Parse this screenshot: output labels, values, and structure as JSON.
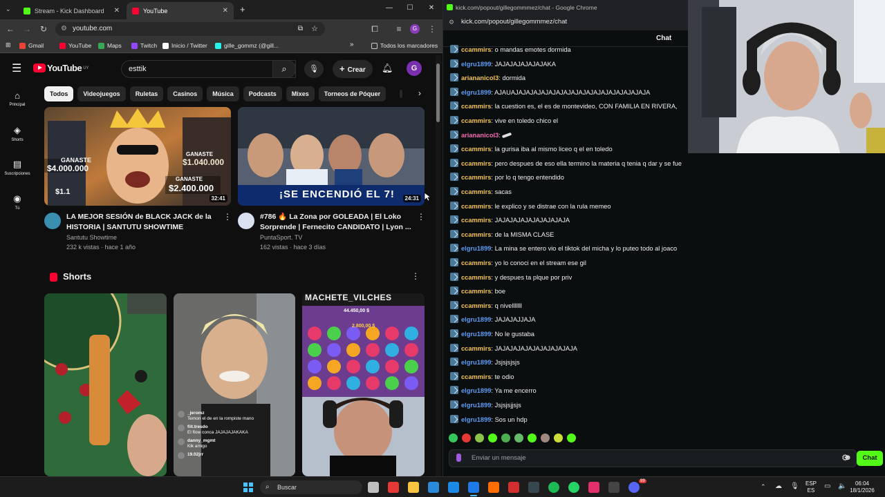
{
  "left_browser": {
    "tabs": [
      {
        "title": "Stream - Kick Dashboard",
        "favicon_color": "#53fc18",
        "active": false
      },
      {
        "title": "YouTube",
        "favicon_color": "#ff0033",
        "active": true
      }
    ],
    "new_tab_icon": "plus-icon",
    "url": "youtube.com",
    "bookmarks": [
      {
        "label": "Gmail",
        "color": "#ea4335"
      },
      {
        "label": "YouTube",
        "color": "#ff0033"
      },
      {
        "label": "Maps",
        "color": "#34a853"
      },
      {
        "label": "Twitch",
        "color": "#9146ff"
      },
      {
        "label": "Inicio / Twitter",
        "color": "#ffffff"
      },
      {
        "label": "gille_gommz (@gill...",
        "color": "#25f4ee"
      }
    ],
    "all_bookmarks": "Todos los marcadores"
  },
  "youtube": {
    "logo_text": "YouTube",
    "logo_region": "UY",
    "search_value": "esttik",
    "create_label": "Crear",
    "account_initial": "G",
    "guide": [
      {
        "label": "Principal",
        "icon": "home-icon"
      },
      {
        "label": "Shorts",
        "icon": "shorts-icon"
      },
      {
        "label": "Suscripciones",
        "icon": "subscriptions-icon"
      },
      {
        "label": "Tú",
        "icon": "you-icon"
      }
    ],
    "chips": [
      "Todos",
      "Videojuegos",
      "Ruletas",
      "Casinos",
      "Música",
      "Podcasts",
      "Mixes",
      "Torneos de Póquer"
    ],
    "videos": [
      {
        "title": "LA MEJOR SESIÓN de BLACK JACK de la HISTORIA | SANTUTU SHOWTIME",
        "channel": "Santutu Showtime",
        "meta": "232 k vistas · hace 1 año",
        "duration": "32:41",
        "overlay_texts": [
          "GANASTE",
          "$4.000.000",
          "GANASTE",
          "$1.040.000",
          "GANASTE",
          "$2.400.000",
          "$1.1"
        ],
        "thumb_color": "#4a3a2a"
      },
      {
        "title": "#786 🔥 La Zona por GOLEADA | El Loko Sorprende | Fernecito CANDIDATO | Lyon ...",
        "channel": "PuntaSport. TV",
        "meta": "162 vistas · hace 3 días",
        "duration": "24:31",
        "overlay_texts": [
          "¡SE ENCENDIÓ EL 7!"
        ],
        "thumb_color": "#3a4250"
      }
    ],
    "shorts_title": "Shorts",
    "shorts": [
      {
        "overlay": "",
        "color": "#2e6a3a"
      },
      {
        "overlay": "",
        "color": "#6a6a68"
      },
      {
        "overlay": "MACHETE_VILCHES",
        "color": "#6c3c8e"
      }
    ],
    "short_chat": [
      {
        "user": "_jeromz",
        "text": "Temon el de en la rompiste mano"
      },
      {
        "user": "fiit.tresdo",
        "text": "El flow conca JAJAJAJAKAKA"
      },
      {
        "user": "danny_mgmt",
        "text": "Klk amigo"
      },
      {
        "user": "19.02jrr",
        "text": ""
      }
    ],
    "slot_values": [
      "44.450,00 $",
      "2.800,00 $"
    ]
  },
  "right_browser": {
    "window_title": "kick.com/popout/gillegommmez/chat - Google Chrome",
    "url": "kick.com/popout/gillegommmez/chat",
    "chat_header": "Chat",
    "input_placeholder": "Enviar un mensaje",
    "send_label": "Chat",
    "messages": [
      {
        "user": "ccammirs",
        "color": "#f5c451",
        "text": "o mandas emotes dormida"
      },
      {
        "user": "elgru1899",
        "color": "#5d9cf5",
        "text": "JAJAJAJAJAJAJAKA"
      },
      {
        "user": "ariananicol3",
        "color": "#f5c451",
        "text": "dormida"
      },
      {
        "user": "elgru1899",
        "color": "#5d9cf5",
        "text": "AJAUAJAJAJAJAJAJAJAJAJAJAJAJAJAJAJAJAJAJA"
      },
      {
        "user": "ccammirs",
        "color": "#f5c451",
        "text": "la cuestion es, el es de montevideo, CON FAMILIA EN RIVERA,"
      },
      {
        "user": "ccammirs",
        "color": "#f5c451",
        "text": "vive en toledo chico el"
      },
      {
        "user": "ariananicol3",
        "color": "#f56bb5",
        "text": ""
      },
      {
        "user": "ccammirs",
        "color": "#f5c451",
        "text": "la gurisa iba al mismo liceo q el en toledo"
      },
      {
        "user": "ccammirs",
        "color": "#f5c451",
        "text": "pero despues de eso ella termino la materia q tenia q dar y se fue"
      },
      {
        "user": "ccammirs",
        "color": "#f5c451",
        "text": "por lo q tengo entendido"
      },
      {
        "user": "ccammirs",
        "color": "#f5c451",
        "text": "sacas"
      },
      {
        "user": "ccammirs",
        "color": "#f5c451",
        "text": "le explico y se distrae con la rula memeo"
      },
      {
        "user": "ccammirs",
        "color": "#f5c451",
        "text": "JAJAJAJAJAJAJAJAJAJA"
      },
      {
        "user": "ccammirs",
        "color": "#f5c451",
        "text": "de la MISMA CLASE"
      },
      {
        "user": "elgru1899",
        "color": "#5d9cf5",
        "text": "La mina se entero vio el tiktok del micha y lo puteo todo al joaco"
      },
      {
        "user": "ccammirs",
        "color": "#f5c451",
        "text": "yo lo conoci en el stream ese gil"
      },
      {
        "user": "ccammirs",
        "color": "#f5c451",
        "text": "y despues ta plque por priv"
      },
      {
        "user": "ccammirs",
        "color": "#f5c451",
        "text": "boe"
      },
      {
        "user": "ccammirs",
        "color": "#f5c451",
        "text": "q nivelllllll"
      },
      {
        "user": "elgru1899",
        "color": "#5d9cf5",
        "text": "JAJAJAJJAJA"
      },
      {
        "user": "elgru1899",
        "color": "#5d9cf5",
        "text": "No le gustaba"
      },
      {
        "user": "ccammirs",
        "color": "#f5c451",
        "text": "JAJAJAJAJAJAJAJAJAJAJA"
      },
      {
        "user": "elgru1899",
        "color": "#5d9cf5",
        "text": "Jsjsjsjsjs"
      },
      {
        "user": "ccammirs",
        "color": "#f5c451",
        "text": "te odio"
      },
      {
        "user": "elgru1899",
        "color": "#5d9cf5",
        "text": "Ya me encerro"
      },
      {
        "user": "elgru1899",
        "color": "#5d9cf5",
        "text": "Jsjsjsjjsjs"
      },
      {
        "user": "elgru1899",
        "color": "#5d9cf5",
        "text": "Sos un hdp"
      }
    ],
    "emote_colors": [
      "#34c759",
      "#e53935",
      "#8bc34a",
      "#53fc18",
      "#4caf50",
      "#66bb6a",
      "#53fc18",
      "#a1887f",
      "#cddc39",
      "#53fc18"
    ]
  },
  "taskbar": {
    "search_label": "Buscar",
    "language": "ESP",
    "region": "ES",
    "time": "06:04",
    "date": "18/1/2026",
    "notification_badge": "99"
  },
  "colors": {
    "kick_green": "#53fc18",
    "youtube_red": "#ff0033"
  }
}
